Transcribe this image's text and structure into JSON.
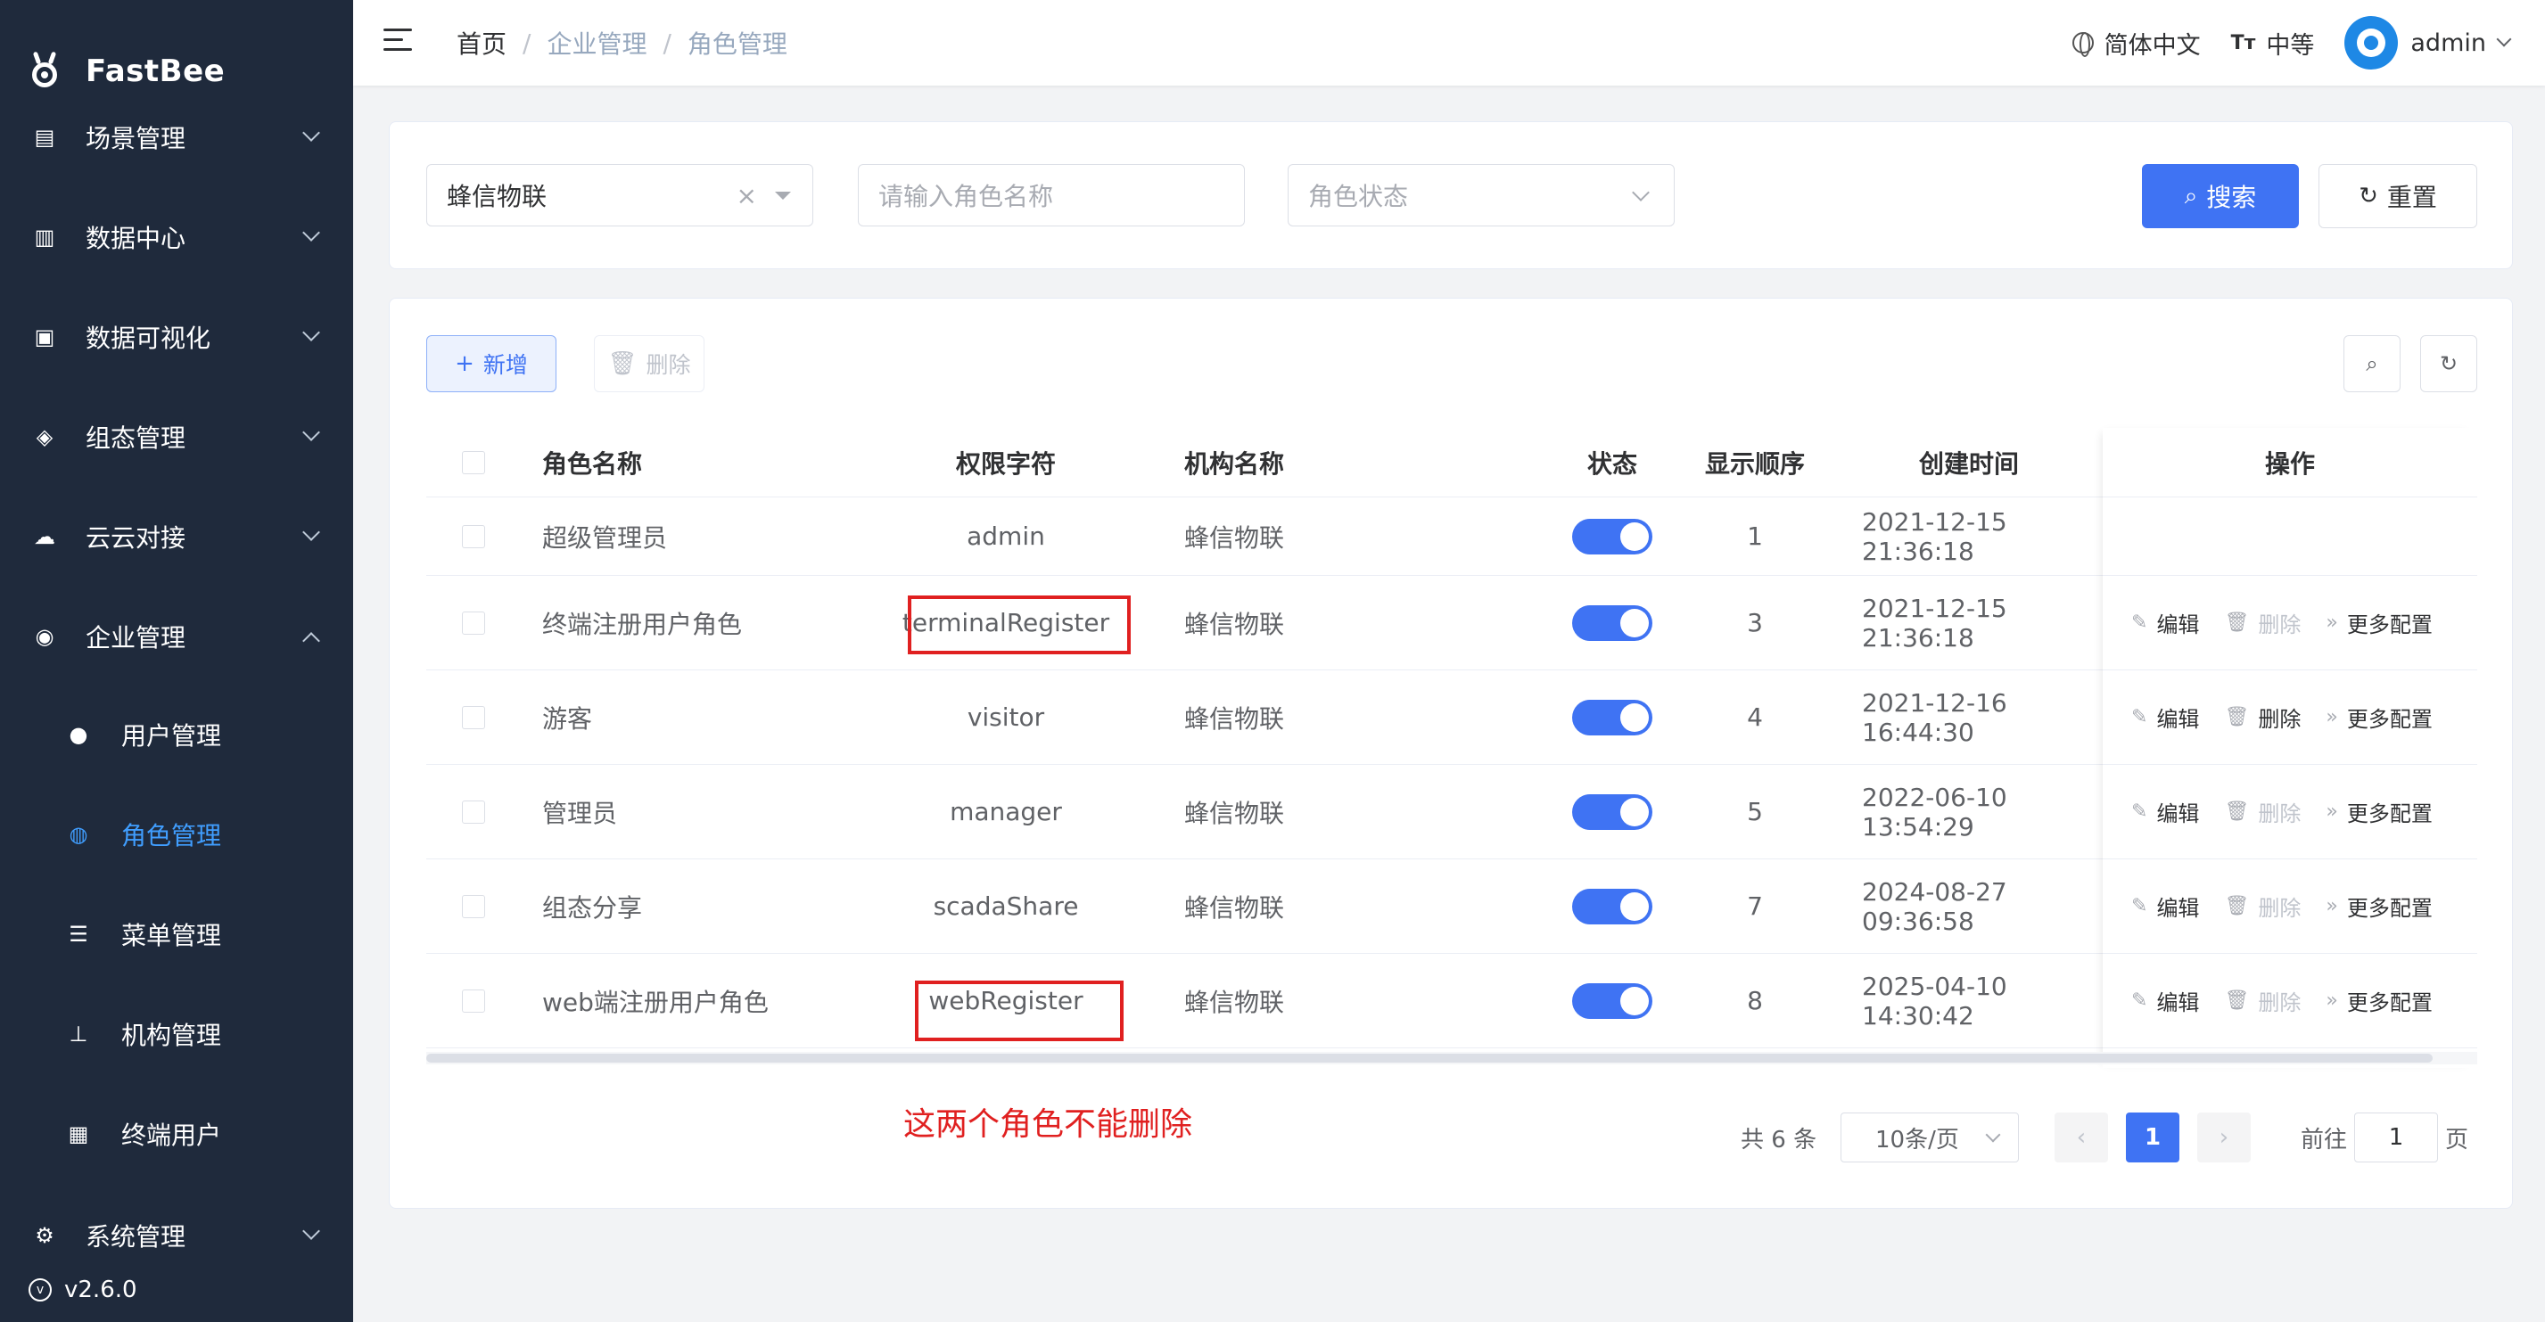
{
  "brand": {
    "name": "FastBee"
  },
  "sidebar": {
    "items": [
      {
        "label": "场景管理",
        "icon": "scene-icon",
        "glyph": "▤"
      },
      {
        "label": "数据中心",
        "icon": "bar-chart-icon",
        "glyph": "▥"
      },
      {
        "label": "数据可视化",
        "icon": "monitor-icon",
        "glyph": "▣"
      },
      {
        "label": "组态管理",
        "icon": "layers-icon",
        "glyph": "◈"
      },
      {
        "label": "云云对接",
        "icon": "cloud-icon",
        "glyph": "☁"
      },
      {
        "label": "企业管理",
        "icon": "enterprise-icon",
        "glyph": "◉"
      },
      {
        "label": "用户管理",
        "icon": "user-icon",
        "glyph": "●"
      },
      {
        "label": "角色管理",
        "icon": "users-icon",
        "glyph": "◍"
      },
      {
        "label": "菜单管理",
        "icon": "menu-list-icon",
        "glyph": "☰"
      },
      {
        "label": "机构管理",
        "icon": "tree-icon",
        "glyph": "⊥"
      },
      {
        "label": "终端用户",
        "icon": "grid-icon",
        "glyph": "▦"
      },
      {
        "label": "系统管理",
        "icon": "settings-icon",
        "glyph": "⚙"
      }
    ],
    "version": "v2.6.0"
  },
  "header": {
    "breadcrumb": [
      "首页",
      "企业管理",
      "角色管理"
    ],
    "language": "简体中文",
    "size": "中等",
    "user": "admin"
  },
  "filter": {
    "org_value": "蜂信物联",
    "role_name_placeholder": "请输入角色名称",
    "status_placeholder": "角色状态",
    "search_label": "搜索",
    "reset_label": "重置"
  },
  "toolbar": {
    "add_label": "新增",
    "delete_label": "删除"
  },
  "table": {
    "headers": [
      "角色名称",
      "权限字符",
      "机构名称",
      "状态",
      "显示顺序",
      "创建时间",
      "操作"
    ],
    "rows": [
      {
        "name": "超级管理员",
        "key": "admin",
        "org": "蜂信物联",
        "status": true,
        "order": "1",
        "created": "2021-12-15 21:36:18",
        "ops": false,
        "deletable": false
      },
      {
        "name": "终端注册用户角色",
        "key": "terminalRegister",
        "org": "蜂信物联",
        "status": true,
        "order": "3",
        "created": "2021-12-15 21:36:18",
        "ops": true,
        "deletable": false
      },
      {
        "name": "游客",
        "key": "visitor",
        "org": "蜂信物联",
        "status": true,
        "order": "4",
        "created": "2021-12-16 16:44:30",
        "ops": true,
        "deletable": true
      },
      {
        "name": "管理员",
        "key": "manager",
        "org": "蜂信物联",
        "status": true,
        "order": "5",
        "created": "2022-06-10 13:54:29",
        "ops": true,
        "deletable": false
      },
      {
        "name": "组态分享",
        "key": "scadaShare",
        "org": "蜂信物联",
        "status": true,
        "order": "7",
        "created": "2024-08-27 09:36:58",
        "ops": true,
        "deletable": false
      },
      {
        "name": "web端注册用户角色",
        "key": "webRegister",
        "org": "蜂信物联",
        "status": true,
        "order": "8",
        "created": "2025-04-10 14:30:42",
        "ops": true,
        "deletable": false
      }
    ],
    "op_labels": {
      "edit": "编辑",
      "delete": "删除",
      "more": "更多配置"
    }
  },
  "annotation": {
    "note": "这两个角色不能删除",
    "color": "#e02020"
  },
  "pagination": {
    "total": "共 6 条",
    "page_size": "10条/页",
    "current_page": "1",
    "goto_label": "前往",
    "goto_value": "1",
    "page_suffix": "页"
  },
  "colors": {
    "primary": "#3f73f3",
    "sidebar": "#1f2a3c",
    "active_menu": "#409eff"
  }
}
